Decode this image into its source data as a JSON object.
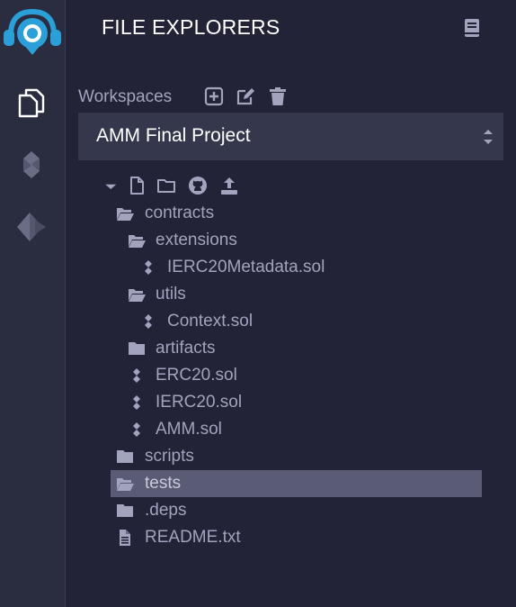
{
  "panel": {
    "title": "FILE EXPLORERS"
  },
  "sidebar": {
    "items": [
      {
        "icon": "file-explorer-icon"
      },
      {
        "icon": "solidity-compiler-icon"
      },
      {
        "icon": "deploy-run-icon"
      }
    ]
  },
  "workspaces": {
    "label": "Workspaces",
    "selected": "AMM Final Project"
  },
  "tree": {
    "rows": [
      {
        "label": "contracts",
        "type": "folder-open"
      },
      {
        "label": "extensions",
        "type": "folder-open"
      },
      {
        "label": "IERC20Metadata.sol",
        "type": "sol"
      },
      {
        "label": "utils",
        "type": "folder-open"
      },
      {
        "label": "Context.sol",
        "type": "sol"
      },
      {
        "label": "artifacts",
        "type": "folder"
      },
      {
        "label": "ERC20.sol",
        "type": "sol"
      },
      {
        "label": "IERC20.sol",
        "type": "sol"
      },
      {
        "label": "AMM.sol",
        "type": "sol"
      },
      {
        "label": "scripts",
        "type": "folder"
      },
      {
        "label": "tests",
        "type": "folder-open",
        "selected": true
      },
      {
        "label": ".deps",
        "type": "folder"
      },
      {
        "label": "README.txt",
        "type": "file"
      }
    ]
  },
  "colors": {
    "background": "#222336",
    "sidebar": "#2a2c3f",
    "selected_row": "#5a5c75",
    "text": "#a2a3bd",
    "logo": "#2a9fd8"
  }
}
